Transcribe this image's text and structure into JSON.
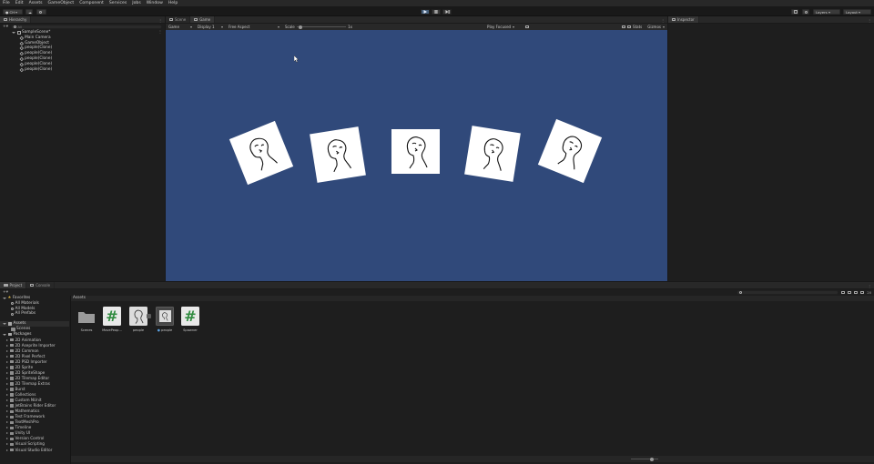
{
  "menu": [
    "File",
    "Edit",
    "Assets",
    "GameObject",
    "Component",
    "Services",
    "Jobs",
    "Window",
    "Help"
  ],
  "toolbar": {
    "account_label": "CH",
    "cloud_label": "☁",
    "layers_label": "Layers",
    "layout_label": "Layout"
  },
  "hierarchy": {
    "tab_label": "Hierarchy",
    "search_placeholder": "All",
    "scene_name": "SampleScene*",
    "items": [
      "Main Camera",
      "GameObject",
      "people(Clone)",
      "people(Clone)",
      "people(Clone)",
      "people(Clone)",
      "people(Clone)"
    ]
  },
  "scene_tab": "Scene",
  "game_tab": "Game",
  "game_bar": {
    "mode": "Game",
    "display": "Display 1",
    "aspect": "Free Aspect",
    "scale_label": "Scale",
    "scale_value": "1x",
    "play_mode": "Play Focused",
    "stats_label": "Stats",
    "gizmos_label": "Gizmos"
  },
  "inspector": {
    "tab_label": "Inspector"
  },
  "project": {
    "tab_project": "Project",
    "tab_console": "Console",
    "favorites_label": "Favorites",
    "favorites": [
      "All Materials",
      "All Models",
      "All Prefabs"
    ],
    "assets_label": "Assets",
    "assets_children": [
      "Scenes"
    ],
    "packages_label": "Packages",
    "packages": [
      "2D Animation",
      "2D Aseprite Importer",
      "2D Common",
      "2D Pixel Perfect",
      "2D PSD Importer",
      "2D Sprite",
      "2D SpriteShape",
      "2D Tilemap Editor",
      "2D Tilemap Extras",
      "Burst",
      "Collections",
      "Custom NUnit",
      "JetBrains Rider Editor",
      "Mathematics",
      "Test Framework",
      "TextMeshPro",
      "Timeline",
      "Unity UI",
      "Version Control",
      "Visual Scripting",
      "Visual Studio Editor"
    ],
    "breadcrumb": "Assets",
    "asset_items": [
      {
        "name": "Scenes",
        "kind": "folder-icon"
      },
      {
        "name": "MovePeop...",
        "kind": "script-icon"
      },
      {
        "name": "people",
        "kind": "sprite-icon"
      },
      {
        "name": "people",
        "kind": "prefab-icon"
      },
      {
        "name": "Spawner",
        "kind": "script-icon"
      }
    ],
    "hidden_count": "20"
  },
  "colors": {
    "game_background": "#30497a",
    "script_accent": "#2f8b3f",
    "play_active": "#46607c"
  }
}
